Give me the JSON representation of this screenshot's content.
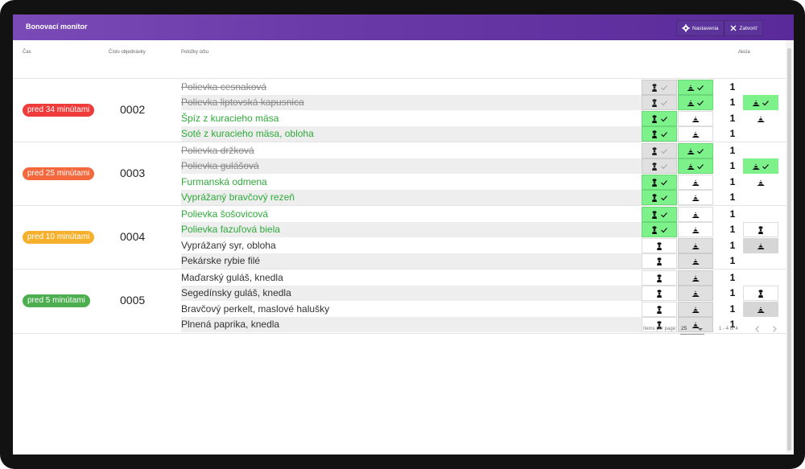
{
  "window": {
    "title": "Bonovací monitor"
  },
  "toolbar": {
    "settings_label": "Nastavenia",
    "close_label": "Zatvoriť"
  },
  "columns": {
    "time": "Čas",
    "order": "Číslo objednávky",
    "items": "Položky účtu",
    "action": "Akcia"
  },
  "colors": {
    "red": "#f03b3b",
    "orange": "#f3683d",
    "amber": "#f6b02b",
    "green_badge": "#4cae4f",
    "item_green": "#2eaa3a",
    "cell_green": "#7ef28a"
  },
  "orders": [
    {
      "time": "pred 34 minútami",
      "number": "0002",
      "badge_color": "red",
      "items": [
        {
          "name": "Polievka cesnaková",
          "qty": "1",
          "state": "done"
        },
        {
          "name": "Polievka liptovská kapusnica",
          "qty": "1",
          "state": "done"
        },
        {
          "name": "Špíz z kuracieho mäsa",
          "qty": "1",
          "state": "ready"
        },
        {
          "name": "Soté z kuracieho mäsa, obloha",
          "qty": "1",
          "state": "ready"
        }
      ]
    },
    {
      "time": "pred 25 minútami",
      "number": "0003",
      "badge_color": "orange",
      "items": [
        {
          "name": "Polievka držková",
          "qty": "1",
          "state": "done"
        },
        {
          "name": "Polievka gulášová",
          "qty": "1",
          "state": "done"
        },
        {
          "name": "Furmanská odmena",
          "qty": "1",
          "state": "ready"
        },
        {
          "name": "Vyprážaný bravčový rezeň",
          "qty": "1",
          "state": "ready"
        }
      ]
    },
    {
      "time": "pred 10 minútami",
      "number": "0004",
      "badge_color": "amber",
      "items": [
        {
          "name": "Polievka šošovicová",
          "qty": "1",
          "state": "ready"
        },
        {
          "name": "Polievka fazuľová biela",
          "qty": "1",
          "state": "ready"
        },
        {
          "name": "Vyprážaný syr, obloha",
          "qty": "1",
          "state": "pending"
        },
        {
          "name": "Pekárske rybie filé",
          "qty": "1",
          "state": "pending"
        }
      ]
    },
    {
      "time": "pred 5 minútami",
      "number": "0005",
      "badge_color": "green_badge",
      "items": [
        {
          "name": "Maďarský guláš, knedla",
          "qty": "1",
          "state": "pending"
        },
        {
          "name": "Segedínsky guláš, knedla",
          "qty": "1",
          "state": "pending"
        },
        {
          "name": "Bravčový perkelt, maslové halušky",
          "qty": "1",
          "state": "pending"
        },
        {
          "name": "Plnená paprika, knedla",
          "qty": "1",
          "state": "pending"
        }
      ]
    }
  ],
  "pagination": {
    "items_per_page_label": "Items per page:",
    "items_per_page": "25",
    "range": "1 - 4 of 4"
  }
}
